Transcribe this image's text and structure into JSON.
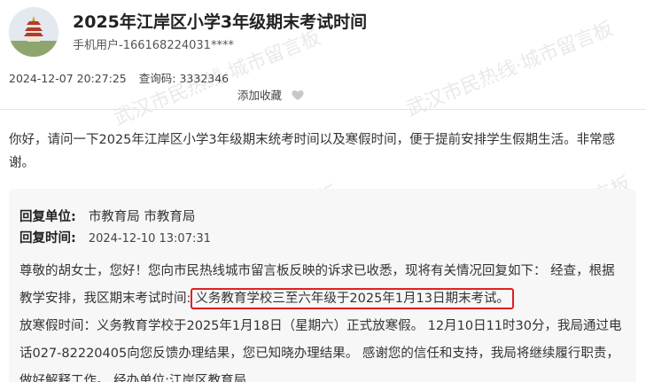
{
  "header": {
    "title": "2025年江岸区小学3年级期末考试时间",
    "author": "手机用户-166168224031****"
  },
  "meta": {
    "datetime": "2024-12-07 20:27:25",
    "query_code_label": "查询码:",
    "query_code": "3332346",
    "favorite_label": "添加收藏"
  },
  "question": {
    "text": "你好，请问一下2025年江岸区小学3年级期末统考时间以及寒假时间，便于提前安排学生假期生活。非常感谢。"
  },
  "reply": {
    "unit_label": "回复单位:",
    "unit_value": "市教育局 市教育局",
    "time_label": "回复时间:",
    "time_value": "2024-12-10 13:07:31",
    "body_part1": "尊敬的胡女士，您好！您向市民热线城市留言板反映的诉求已收悉，现将有关情况回复如下： 经查，根据教学安排，我区期末考试时间:",
    "body_highlight": "义务教育学校三至六年级于2025年1月13日期末考试。",
    "body_part2": "放寒假时间：义务教育学校于2025年1月18日（星期六）正式放寒假。 12月10日11时30分，我局通过电话027-82220405向您反馈办理结果，您已知晓办理结果。 感谢您的信任和支持，我局将继续履行职责，做好解释工作。 经办单位:江岸区教育局"
  },
  "watermark": {
    "text": "武汉市民热线·城市留言板"
  },
  "colors": {
    "highlight_border": "#e02020",
    "reply_bg": "#f7f7f7"
  }
}
